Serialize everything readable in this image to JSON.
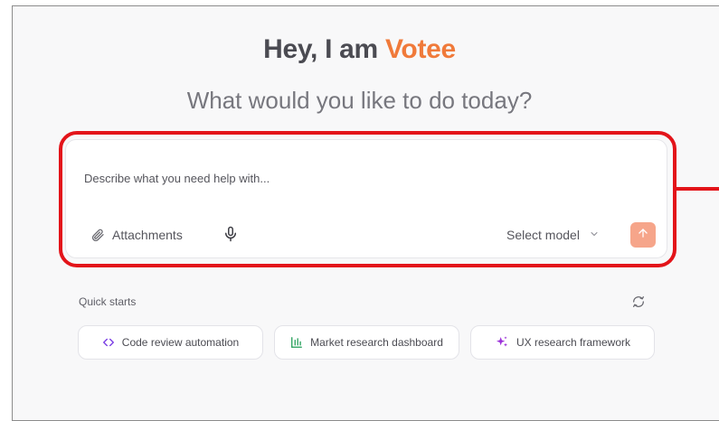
{
  "hero": {
    "greeting_prefix": "Hey, I am ",
    "brand_name": "Votee",
    "subtitle": "What would you like to do today?"
  },
  "composer": {
    "placeholder": "Describe what you need help with...",
    "attachments_label": "Attachments",
    "model_select_label": "Select model"
  },
  "quick_starts": {
    "label": "Quick starts",
    "items": [
      {
        "label": "Code review automation",
        "icon": "code-icon",
        "color": "#7b3fe4"
      },
      {
        "label": "Market research dashboard",
        "icon": "bar-chart-icon",
        "color": "#1f9d55"
      },
      {
        "label": "UX research framework",
        "icon": "sparkle-icon",
        "color": "#9b30d9"
      }
    ]
  },
  "colors": {
    "brand": "#f07a3a",
    "send_button": "#f6a58a",
    "highlight": "#e3141a"
  }
}
